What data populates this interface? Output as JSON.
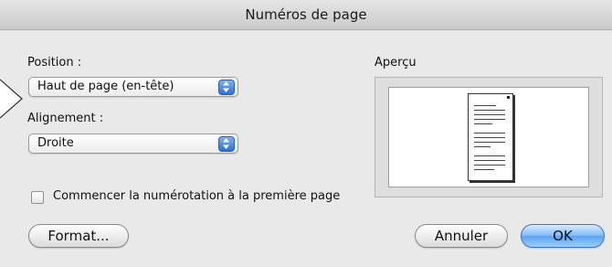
{
  "dialog": {
    "title": "Numéros de page",
    "position_label": "Position :",
    "position_value": "Haut de page (en-tête)",
    "alignment_label": "Alignement :",
    "alignment_value": "Droite",
    "first_page_checkbox_label": "Commencer la numérotation à la première page",
    "first_page_checked": false,
    "preview_label": "Aperçu",
    "format_button": "Format...",
    "cancel_button": "Annuler",
    "ok_button": "OK"
  },
  "icons": {
    "stepper": "up-down-arrows-icon",
    "pointer": "callout-pointer-icon",
    "preview": "page-preview-icon"
  },
  "colors": {
    "accent_blue": "#5aa2f0",
    "dialog_bg": "#e9e9e9"
  }
}
